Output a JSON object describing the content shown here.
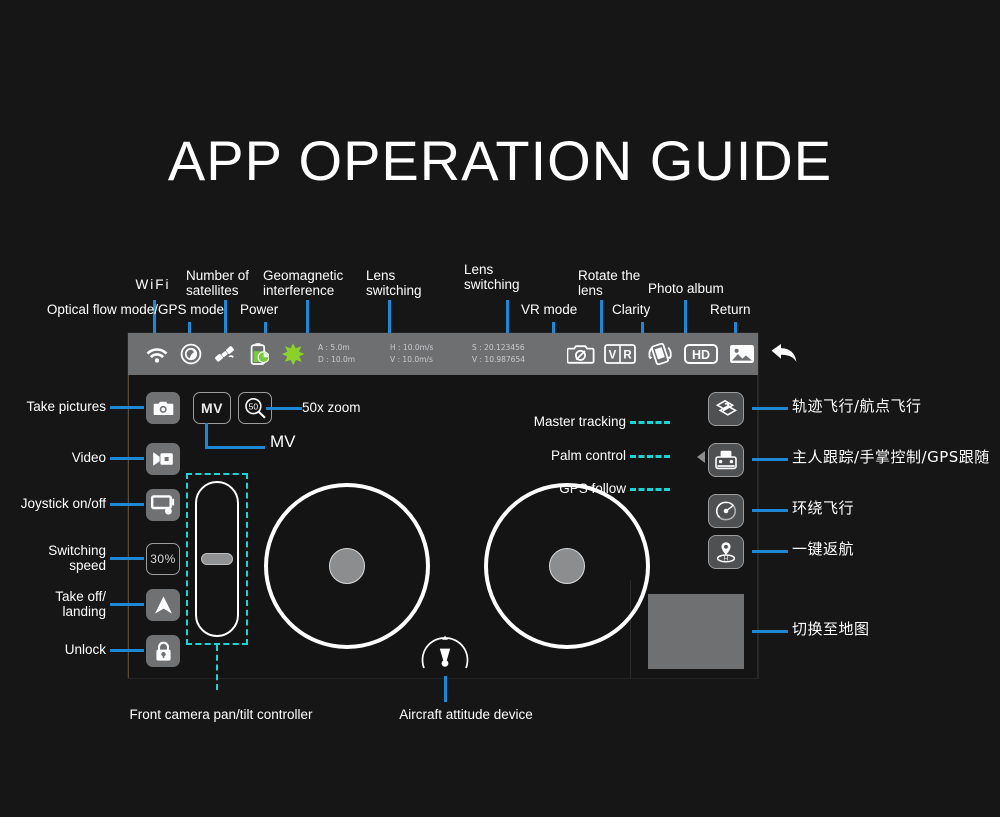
{
  "page": {
    "title": "APP OPERATION GUIDE",
    "background_color": "#161616",
    "accent_line_color": "#1e87d6",
    "dashed_accent_color": "#19d6d6",
    "statusbar_color": "#6d6f71",
    "button_color": "#6f7173"
  },
  "statusbar": {
    "icons": [
      {
        "name": "wifi-icon",
        "label": "WiFi"
      },
      {
        "name": "optical-flow-gps-mode-icon",
        "label": "Optical flow mode/GPS mode"
      },
      {
        "name": "satellite-icon",
        "label": "Number of satellites"
      },
      {
        "name": "battery-icon",
        "label": "Power"
      },
      {
        "name": "geomagnetic-icon",
        "label": "Geomagnetic interference"
      },
      {
        "name": "lens-switching-icon",
        "label": "Lens switching"
      },
      {
        "name": "vr-mode-icon",
        "label": "VR mode"
      },
      {
        "name": "rotate-lens-icon",
        "label": "Rotate the lens"
      },
      {
        "name": "clarity-hd-icon",
        "label": "Clarity"
      },
      {
        "name": "photo-album-icon",
        "label": "Photo album"
      },
      {
        "name": "return-icon",
        "label": "Return"
      }
    ],
    "telemetry": [
      {
        "top": "A : 5.0m",
        "bottom": "D : 10.0m"
      },
      {
        "top": "H : 10.0m/s",
        "bottom": "V : 10.0m/s"
      },
      {
        "top": "S : 20.123456",
        "bottom": "V : 10.987654"
      }
    ],
    "clarity_text": "HD",
    "vr_text_left": "V",
    "vr_text_right": "R"
  },
  "left_controls": {
    "take_pictures": {
      "label": "Take pictures",
      "icon": "camera-icon"
    },
    "video": {
      "label": "Video",
      "icon": "video-icon"
    },
    "joystick_toggle": {
      "label": "Joystick on/off",
      "icon": "joystick-toggle-icon"
    },
    "switching_speed": {
      "label": "Switching\nspeed",
      "value": "30%"
    },
    "takeoff_landing": {
      "label": "Take off/\nlanding",
      "icon": "takeoff-arrow-icon"
    },
    "unlock": {
      "label": "Unlock",
      "icon": "lock-icon"
    },
    "mv": {
      "button_text": "MV",
      "label": "MV"
    },
    "zoom": {
      "button_text": "50",
      "label": "50x zoom"
    }
  },
  "center_labels": {
    "pantilt": "Front camera pan/tilt controller",
    "attitude": "Aircraft attitude device"
  },
  "tracking_labels": {
    "master_tracking": "Master tracking",
    "palm_control": "Palm control",
    "gps_follow": "GPS follow"
  },
  "right_controls": [
    {
      "icon": "waypoint-flight-icon",
      "label": "轨迹飞行/航点飞行"
    },
    {
      "icon": "remote-follow-icon",
      "label": "主人跟踪/手掌控制/GPS跟随"
    },
    {
      "icon": "orbit-flight-icon",
      "label": "环绕飞行"
    },
    {
      "icon": "return-home-icon",
      "label": "一键返航"
    },
    {
      "icon": "map-thumbnail",
      "label": "切换至地图"
    }
  ]
}
